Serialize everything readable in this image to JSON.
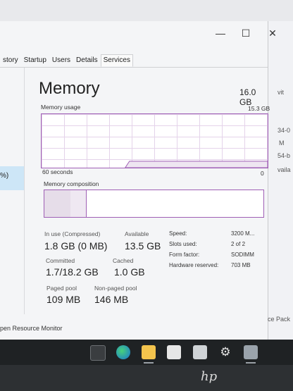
{
  "window": {
    "tabs": [
      "story",
      "Startup",
      "Users",
      "Details",
      "Services"
    ],
    "left_selected_text": "%)",
    "controls": {
      "minimize": "—",
      "maximize": "☐",
      "close": "✕"
    }
  },
  "memory": {
    "title": "Memory",
    "total": "16.0 GB",
    "usage_label": "Memory usage",
    "usage_max": "15.3 GB",
    "axis_left": "60 seconds",
    "axis_right": "0",
    "composition_label": "Memory composition",
    "usage_fraction_recent": 0.12,
    "composition": {
      "in_use_fraction": 0.12,
      "modified_fraction": 0.07
    }
  },
  "stats": {
    "in_use_label": "In use (Compressed)",
    "in_use_value": "1.8 GB (0 MB)",
    "available_label": "Available",
    "available_value": "13.5 GB",
    "committed_label": "Committed",
    "committed_value": "1.7/18.2 GB",
    "cached_label": "Cached",
    "cached_value": "1.0 GB",
    "paged_label": "Paged pool",
    "paged_value": "109 MB",
    "nonpaged_label": "Non-paged pool",
    "nonpaged_value": "146 MB"
  },
  "details": [
    {
      "key": "Speed:",
      "value": "3200 M..."
    },
    {
      "key": "Slots used:",
      "value": "2 of 2"
    },
    {
      "key": "Form factor:",
      "value": "SODIMM"
    },
    {
      "key": "Hardware reserved:",
      "value": "703 MB"
    }
  ],
  "footer": {
    "resource_monitor": "pen Resource Monitor",
    "right_text": "ce Pack"
  },
  "background_window": {
    "fragments": [
      "vit",
      "34-0",
      "M",
      "54-b",
      "vaila"
    ]
  },
  "laptop": {
    "logo": "hp"
  }
}
